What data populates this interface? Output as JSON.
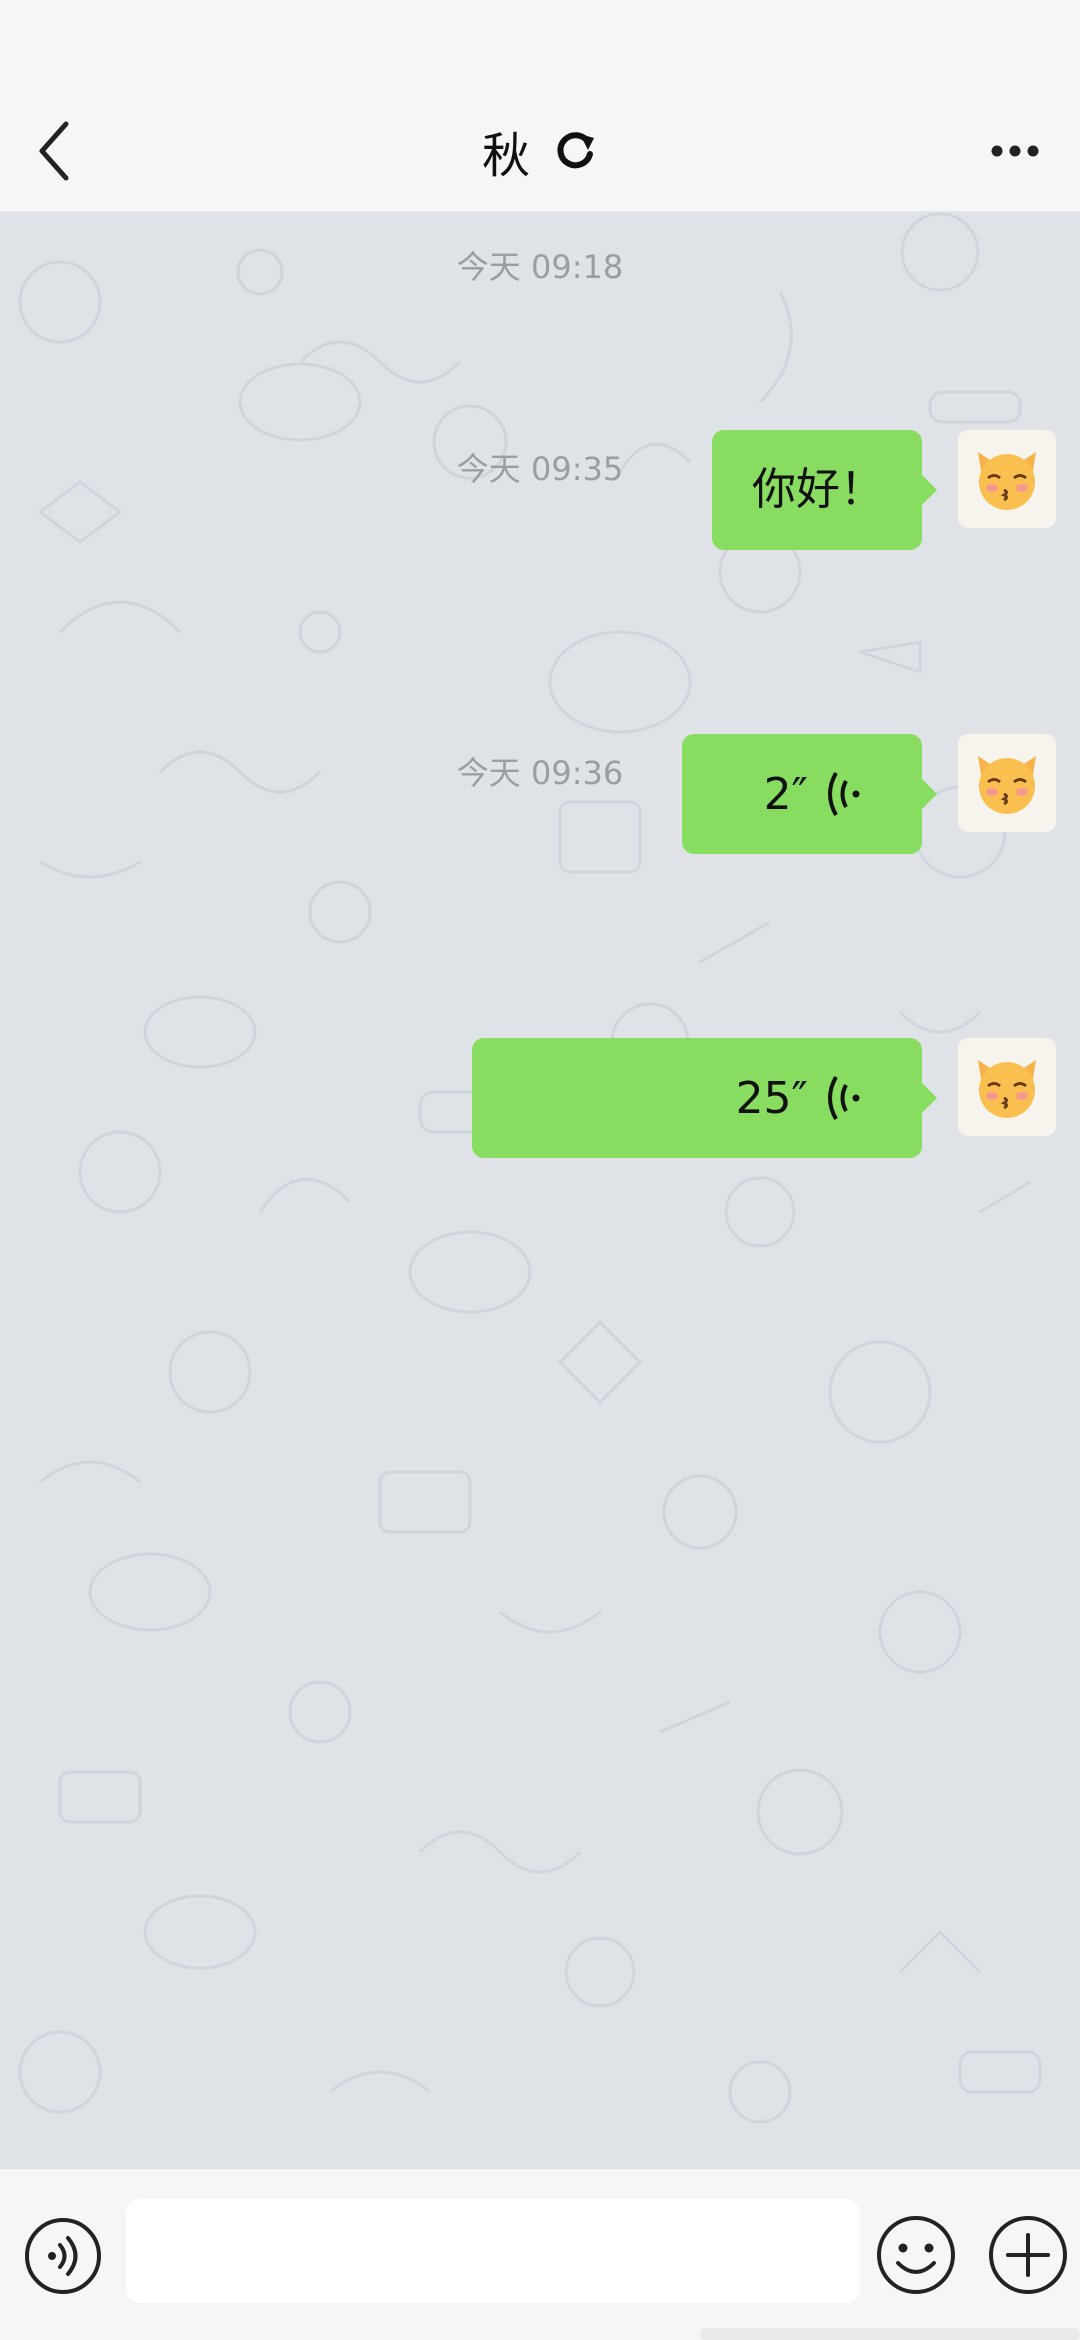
{
  "header": {
    "title": "秋",
    "back_icon": "chevron-left-icon",
    "status_icon": "refresh-icon",
    "more_icon": "more-dots-icon"
  },
  "messages": [
    {
      "timestamp": "今天 09:18",
      "type": "text",
      "text": "你好！",
      "avatar": "kissing-cat-emoji"
    },
    {
      "timestamp": "今天 09:35",
      "type": "voice",
      "duration": "2″",
      "avatar": "kissing-cat-emoji"
    },
    {
      "timestamp": "今天 09:36",
      "type": "voice",
      "duration": "25″",
      "avatar": "kissing-cat-emoji"
    }
  ],
  "input_bar": {
    "voice_mode_icon": "voice-mode-icon",
    "text_value": "",
    "emoji_icon": "smiley-icon",
    "plus_icon": "plus-circle-icon"
  },
  "colors": {
    "bubble": "#88dc5f",
    "chat_background": "#dfe3e8",
    "bar_background": "#f6f6f6",
    "timestamp": "#9a9da1"
  }
}
